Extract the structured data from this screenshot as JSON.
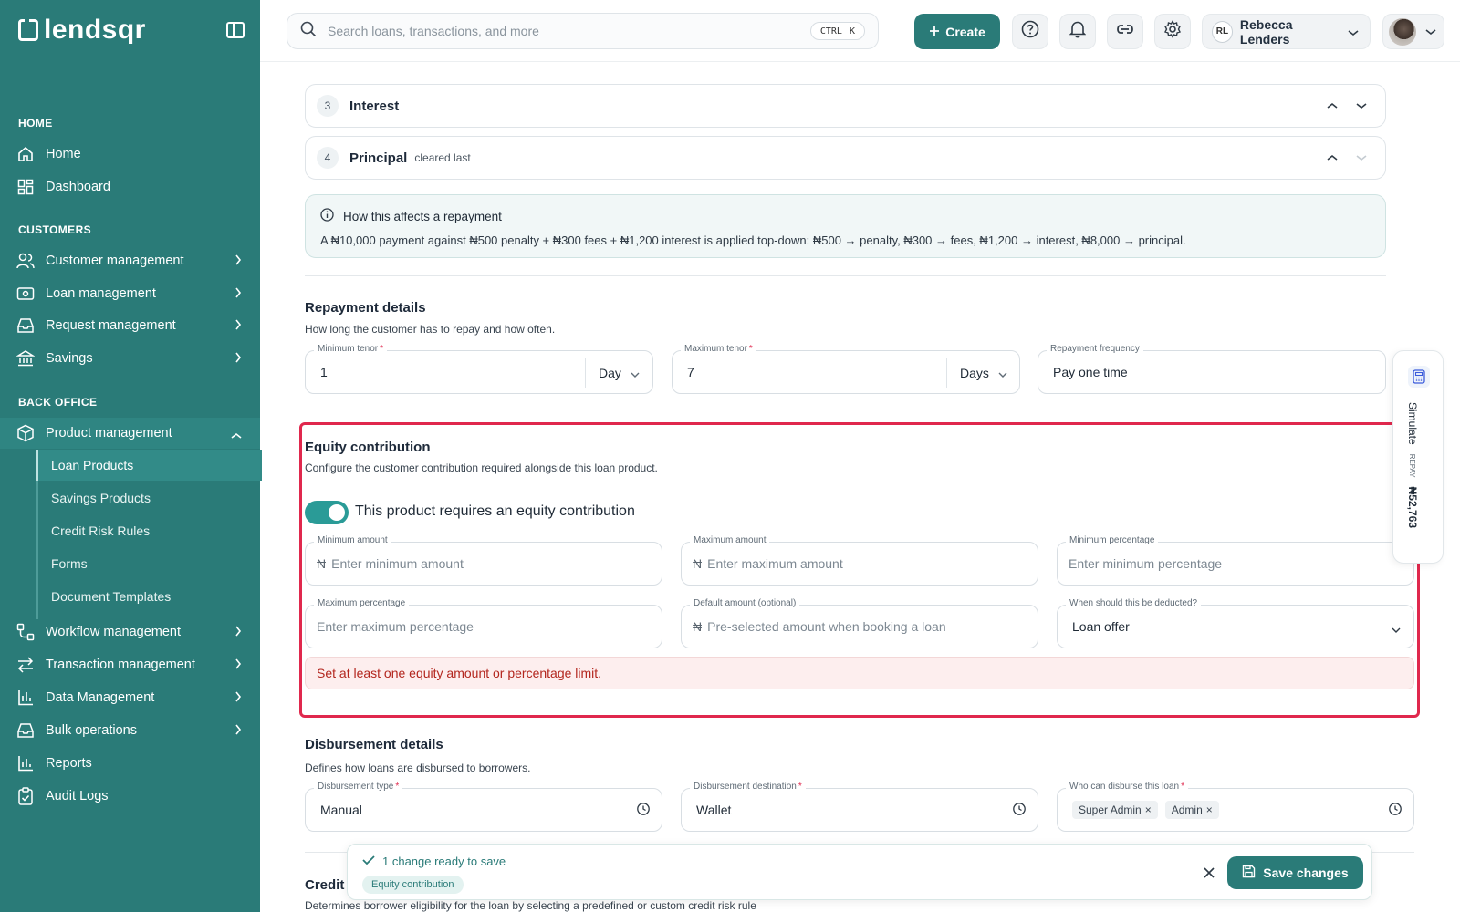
{
  "brand": {
    "name": "lendsqr"
  },
  "sidebar": {
    "sections": {
      "home": "HOME",
      "customers": "CUSTOMERS",
      "back_office": "BACK OFFICE"
    },
    "items": {
      "home": "Home",
      "dashboard": "Dashboard",
      "customer_management": "Customer management",
      "loan_management": "Loan management",
      "request_management": "Request management",
      "savings": "Savings",
      "product_management": "Product management",
      "workflow_management": "Workflow management",
      "transaction_management": "Transaction management",
      "data_management": "Data Management",
      "bulk_operations": "Bulk operations",
      "reports": "Reports",
      "audit_logs": "Audit Logs"
    },
    "sub_items": [
      "Loan Products",
      "Savings Products",
      "Credit Risk Rules",
      "Forms",
      "Document Templates"
    ],
    "active_sub_item": "Loan Products"
  },
  "topbar": {
    "search_placeholder": "Search loans, transactions, and more",
    "shortcut_mod": "CTRL",
    "shortcut_key": "K",
    "create_label": "Create",
    "user_initials": "RL",
    "user_name": "Rebecca Lenders"
  },
  "allocation": {
    "rules": [
      {
        "num": "3",
        "title": "Interest",
        "subtitle": ""
      },
      {
        "num": "4",
        "title": "Principal",
        "subtitle": "cleared last"
      }
    ],
    "info_title": "How this affects a repayment",
    "info_body": "A ₦10,000 payment against ₦500 penalty + ₦300 fees + ₦1,200 interest is applied top-down: ₦500 → penalty, ₦300 → fees, ₦1,200 → interest, ₦8,000 → principal."
  },
  "repayment": {
    "title": "Repayment details",
    "desc": "How long the customer has to repay and how often.",
    "min_tenor_label": "Minimum tenor",
    "min_tenor_value": "1",
    "min_tenor_unit": "Day",
    "max_tenor_label": "Maximum tenor",
    "max_tenor_value": "7",
    "max_tenor_unit": "Days",
    "frequency_label": "Repayment frequency",
    "frequency_value": "Pay one time"
  },
  "equity": {
    "title": "Equity contribution",
    "desc": "Configure the customer contribution required alongside this loan product.",
    "toggle_label": "This product requires an equity contribution",
    "toggle_on": true,
    "currency": "₦",
    "min_amount_label": "Minimum amount",
    "min_amount_placeholder": "Enter minimum amount",
    "max_amount_label": "Maximum amount",
    "max_amount_placeholder": "Enter maximum amount",
    "min_pct_label": "Minimum percentage",
    "min_pct_placeholder": "Enter minimum percentage",
    "max_pct_label": "Maximum percentage",
    "max_pct_placeholder": "Enter maximum percentage",
    "default_label": "Default amount (optional)",
    "default_placeholder": "Pre-selected amount when booking a loan",
    "deduct_label": "When should this be deducted?",
    "deduct_value": "Loan offer",
    "error": "Set at least one equity amount or percentage limit."
  },
  "disbursement": {
    "title": "Disbursement details",
    "desc": "Defines how loans are disbursed to borrowers.",
    "type_label": "Disbursement type",
    "type_value": "Manual",
    "dest_label": "Disbursement destination",
    "dest_value": "Wallet",
    "who_label": "Who can disburse this loan",
    "who_chips": [
      "Super Admin",
      "Admin"
    ]
  },
  "simulate": {
    "label": "Simulate",
    "small": "REPAY",
    "amount": "₦52,763"
  },
  "save_bar": {
    "message": "1 change ready to save",
    "chip": "Equity contribution",
    "button": "Save changes"
  },
  "credit": {
    "title": "Credit",
    "desc": "Determines borrower eligibility for the loan by selecting a predefined or custom credit risk rule"
  },
  "colors": {
    "brand": "#2a7b78",
    "error": "#e0284d"
  }
}
